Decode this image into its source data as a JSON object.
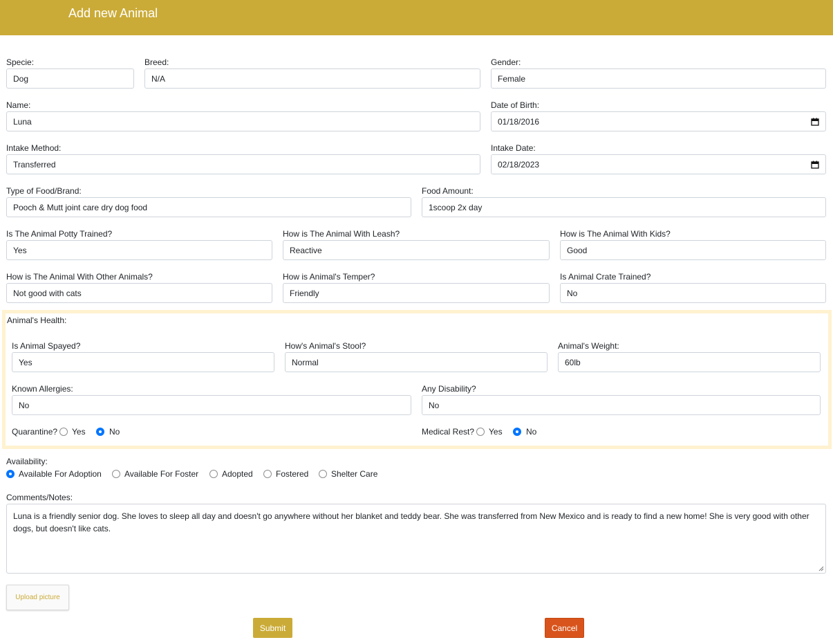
{
  "header": {
    "title": "Add new Animal"
  },
  "fields": {
    "specie": {
      "label": "Specie:",
      "value": "Dog"
    },
    "breed": {
      "label": "Breed:",
      "value": "N/A"
    },
    "gender": {
      "label": "Gender:",
      "value": "Female"
    },
    "name": {
      "label": "Name:",
      "value": "Luna"
    },
    "dob": {
      "label": "Date of Birth:",
      "value": "01/18/2016"
    },
    "intake_method": {
      "label": "Intake Method:",
      "value": "Transferred"
    },
    "intake_date": {
      "label": "Intake Date:",
      "value": "02/18/2023"
    },
    "food_type": {
      "label": "Type of Food/Brand:",
      "value": "Pooch & Mutt joint care dry dog food"
    },
    "food_amount": {
      "label": "Food Amount:",
      "value": "1scoop 2x day"
    },
    "potty": {
      "label": "Is The Animal Potty Trained?",
      "value": "Yes"
    },
    "leash": {
      "label": "How is The Animal With Leash?",
      "value": "Reactive"
    },
    "kids": {
      "label": "How is The Animal With Kids?",
      "value": "Good"
    },
    "other_animals": {
      "label": "How is The Animal With Other Animals?",
      "value": "Not good with cats"
    },
    "temper": {
      "label": "How is Animal's Temper?",
      "value": "Friendly"
    },
    "crate": {
      "label": "Is Animal Crate Trained?",
      "value": "No"
    }
  },
  "health": {
    "title": "Animal's Health:",
    "spayed": {
      "label": "Is Animal Spayed?",
      "value": "Yes"
    },
    "stool": {
      "label": "How's Animal's Stool?",
      "value": "Normal"
    },
    "weight": {
      "label": "Animal's Weight:",
      "value": "60lb"
    },
    "allergies": {
      "label": "Known Allergies:",
      "value": "No"
    },
    "disability": {
      "label": "Any Disability?",
      "value": "No"
    },
    "quarantine": {
      "label": "Quarantine?",
      "options": [
        "Yes",
        "No"
      ],
      "selected": "No"
    },
    "medical_rest": {
      "label": "Medical Rest?",
      "options": [
        "Yes",
        "No"
      ],
      "selected": "No"
    }
  },
  "availability": {
    "label": "Availability:",
    "options": [
      "Available For Adoption",
      "Available For Foster",
      "Adopted",
      "Fostered",
      "Shelter Care"
    ],
    "selected": "Available For Adoption"
  },
  "comments": {
    "label": "Comments/Notes:",
    "value": "Luna is a friendly senior dog. She loves to sleep all day and doesn't go anywhere without her blanket and teddy bear. She was transferred from New Mexico and is ready to find a new home! She is very good with other dogs, but doesn't like cats."
  },
  "actions": {
    "upload": "Upload picture",
    "submit": "Submit",
    "cancel": "Cancel"
  },
  "colors": {
    "brand": "#cbab37",
    "cancel": "#d8541c",
    "radio_selected": "#0075ff",
    "health_border": "#fff2cf"
  },
  "icons": {
    "date_picker": "calendar-icon"
  }
}
